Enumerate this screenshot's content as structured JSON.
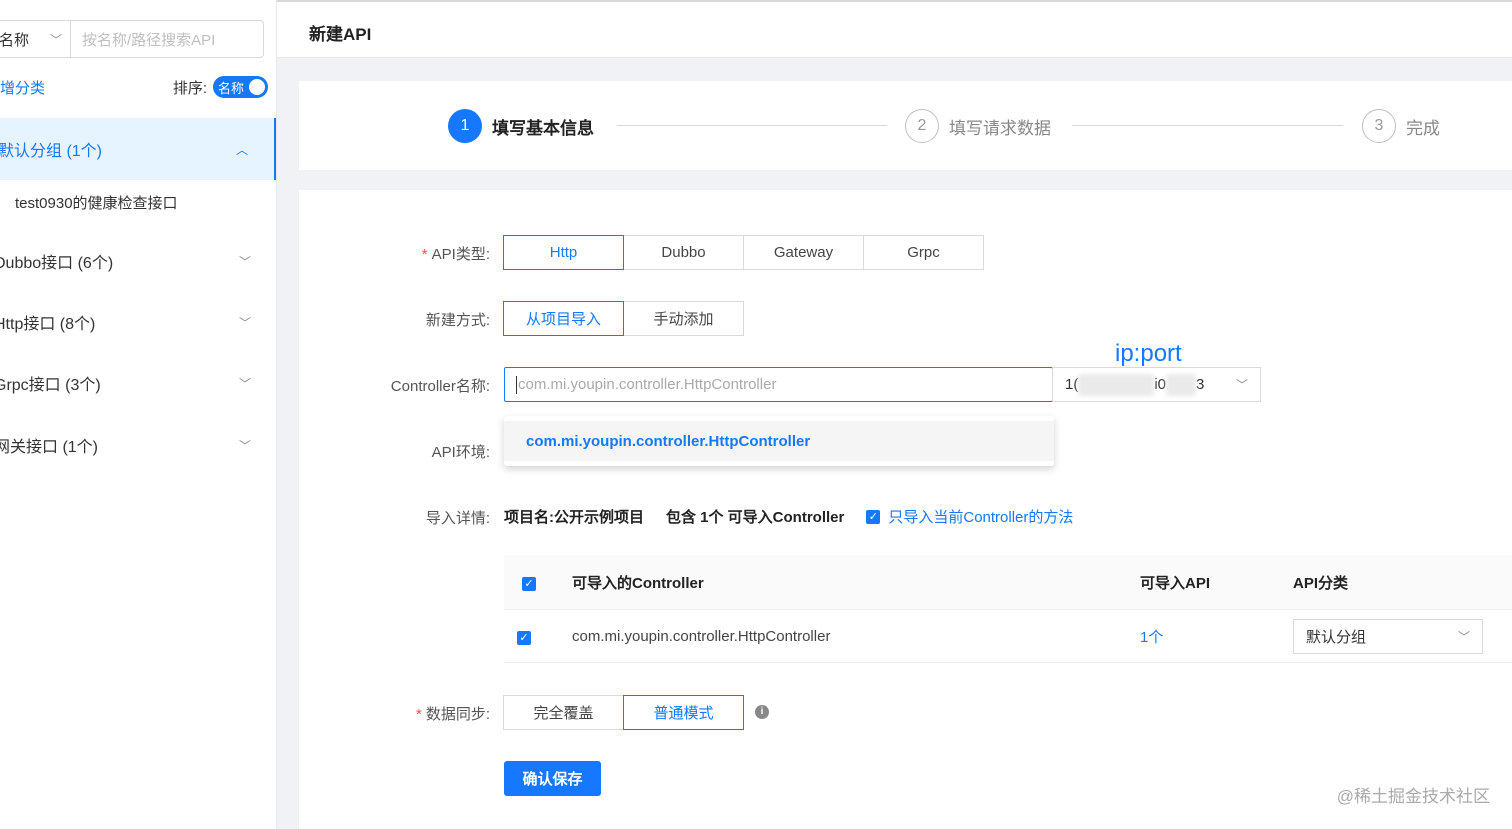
{
  "sidebar": {
    "search_type": "名称",
    "search_placeholder": "按名称/路径搜索API",
    "add_category": "增分类",
    "sort_label": "排序:",
    "sort_switch": "名称",
    "groups": [
      {
        "label": "默认分组 (1个)",
        "expanded": true
      },
      {
        "label": "Dubbo接口 (6个)",
        "expanded": false
      },
      {
        "label": "Http接口 (8个)",
        "expanded": false
      },
      {
        "label": "Grpc接口 (3个)",
        "expanded": false
      },
      {
        "label": "网关接口 (1个)",
        "expanded": false
      }
    ],
    "sub_item": "test0930的健康检查接口"
  },
  "header": {
    "title": "新建API"
  },
  "steps": [
    {
      "num": "1",
      "label": "填写基本信息",
      "status": "current"
    },
    {
      "num": "2",
      "label": "填写请求数据",
      "status": "wait"
    },
    {
      "num": "3",
      "label": "完成",
      "status": "wait"
    }
  ],
  "form": {
    "api_type_label": "API类型:",
    "api_types": [
      "Http",
      "Dubbo",
      "Gateway",
      "Grpc"
    ],
    "api_type_selected": "Http",
    "create_mode_label": "新建方式:",
    "create_modes": [
      "从项目导入",
      "手动添加"
    ],
    "create_mode_selected": "从项目导入",
    "controller_label": "Controller名称:",
    "controller_value": "com.mi.youpin.controller.HttpController",
    "ip_prefix": "1(",
    "ip_mid": "i0",
    "ip_suffix": "3",
    "ip_note": "ip:port",
    "dropdown_option": "com.mi.youpin.controller.HttpController",
    "env_label": "API环境:",
    "import_detail_label": "导入详情:",
    "project_name": "项目名:公开示例项目",
    "contains": "包含 1个 可导入Controller",
    "only_current": "只导入当前Controller的方法",
    "table": {
      "headers": [
        "可导入的Controller",
        "可导入API",
        "API分类"
      ],
      "rows": [
        {
          "controller": "com.mi.youpin.controller.HttpController",
          "api_count": "1个",
          "category": "默认分组"
        }
      ]
    },
    "sync_label": "数据同步:",
    "sync_modes": [
      "完全覆盖",
      "普通模式"
    ],
    "sync_selected": "普通模式",
    "save_button": "确认保存"
  },
  "watermark": "@稀土掘金技术社区",
  "colors": {
    "accent": "#1677ff",
    "required": "#ff4d4f"
  },
  "icons": [
    "chevron-down-icon",
    "chevron-up-icon",
    "check-icon",
    "info-icon"
  ]
}
